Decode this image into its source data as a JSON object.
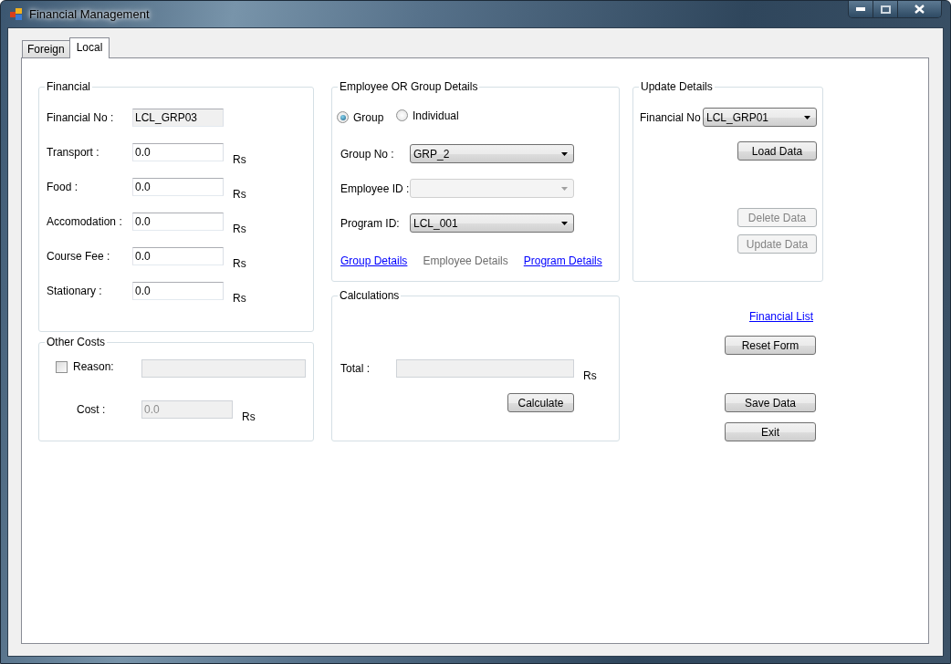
{
  "window": {
    "title": "Financial Management"
  },
  "tabs": [
    {
      "label": "Foreign",
      "selected": false
    },
    {
      "label": "Local",
      "selected": true
    }
  ],
  "financial": {
    "title": "Financial",
    "fields": [
      {
        "label": "Financial No :",
        "value": "LCL_GRP03",
        "readonly": true
      },
      {
        "label": "Transport :",
        "value": "0.0",
        "readonly": false,
        "unit": "Rs"
      },
      {
        "label": "Food :",
        "value": "0.0",
        "readonly": false,
        "unit": "Rs"
      },
      {
        "label": "Accomodation :",
        "value": "0.0",
        "readonly": false,
        "unit": "Rs"
      },
      {
        "label": "Course Fee :",
        "value": "0.0",
        "readonly": false,
        "unit": "Rs"
      },
      {
        "label": "Stationary :",
        "value": "0.0",
        "readonly": false,
        "unit": "Rs"
      }
    ]
  },
  "other_costs": {
    "title": "Other Costs",
    "reason": {
      "label": "Reason:",
      "checked": false,
      "disabled": true
    },
    "cost": {
      "label": "Cost :",
      "value": "0.0",
      "unit": "Rs",
      "disabled": true
    }
  },
  "employee": {
    "title": "Employee OR Group Details",
    "radios": [
      {
        "label": "Group",
        "selected": true
      },
      {
        "label": "Individual",
        "selected": false
      }
    ],
    "combos": [
      {
        "label": "Group No :",
        "value": "GRP_2",
        "disabled": false
      },
      {
        "label": "Employee ID :",
        "disabled": true
      },
      {
        "label": "Program ID:",
        "value": "LCL_001",
        "disabled": false
      }
    ],
    "links": [
      {
        "label": "Group Details",
        "disabled": false
      },
      {
        "label": "Employee Details",
        "disabled": true
      },
      {
        "label": "Program Details",
        "disabled": false
      }
    ]
  },
  "calculations": {
    "title": "Calculations",
    "total": {
      "label": "Total :",
      "unit": "Rs",
      "disabled": true
    },
    "button": {
      "label": "Calculate",
      "disabled": false
    }
  },
  "update": {
    "title": "Update Details",
    "financial_no": {
      "label": "Financial No",
      "value": "LCL_GRP01",
      "disabled": false
    },
    "buttons": [
      {
        "label": "Load Data",
        "disabled": false
      },
      {
        "label": "Delete Data",
        "disabled": true
      },
      {
        "label": "Update Data",
        "disabled": true
      }
    ]
  },
  "actions": {
    "link": "Financial List",
    "buttons": [
      {
        "label": "Reset Form",
        "disabled": false
      },
      {
        "label": "Save Data",
        "disabled": false
      },
      {
        "label": "Exit",
        "disabled": false
      }
    ]
  }
}
